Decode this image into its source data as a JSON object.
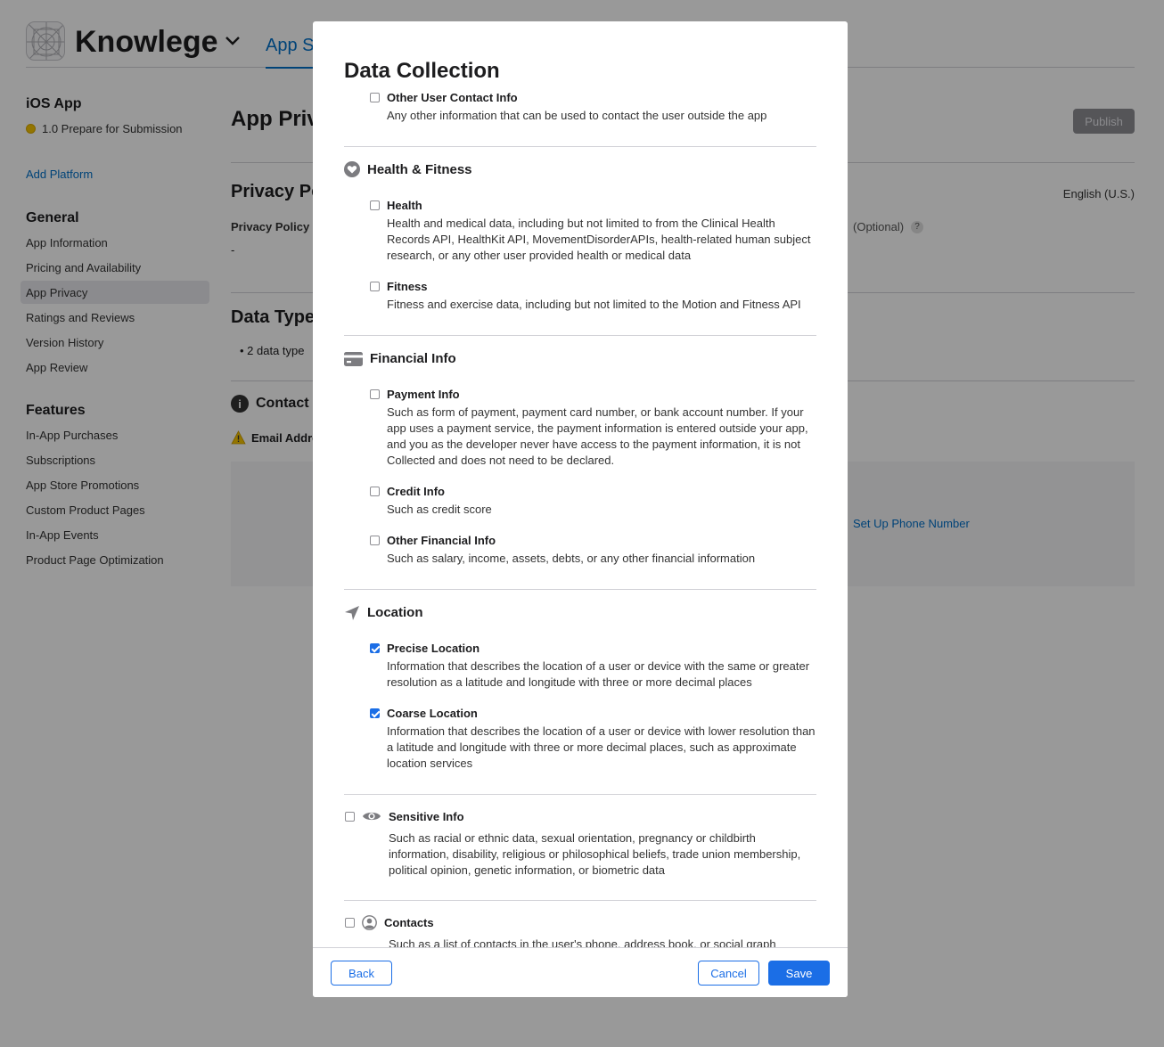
{
  "app": {
    "title": "Knowlege",
    "tab_appstore": "App St"
  },
  "sidebar": {
    "platform": "iOS App",
    "status": "1.0 Prepare for Submission",
    "add_platform": "Add Platform",
    "general_header": "General",
    "general_items": [
      "App Information",
      "Pricing and Availability",
      "App Privacy",
      "Ratings and Reviews",
      "Version History",
      "App Review"
    ],
    "features_header": "Features",
    "feature_items": [
      "In-App Purchases",
      "Subscriptions",
      "App Store Promotions",
      "Custom Product Pages",
      "In-App Events",
      "Product Page Optimization"
    ]
  },
  "main": {
    "title": "App Priv",
    "publish": "Publish",
    "privacy_policy_heading": "Privacy Po",
    "language": "English (U.S.)",
    "privacy_policy_url_label": "Privacy Policy U",
    "privacy_policy_url_value": "-",
    "optional_label": "(Optional)",
    "help_mark": "?",
    "data_types_heading": "Data Type",
    "data_types_bullet": "2 data type",
    "contact_info": "Contact I",
    "email_warning": "Email Addre",
    "set_up_phone": "Set Up Phone Number"
  },
  "modal": {
    "title": "Data Collection",
    "items": {
      "other_contact": {
        "title": "Other User Contact Info",
        "desc": "Any other information that can be used to contact the user outside the app"
      },
      "health": {
        "title": "Health",
        "desc": "Health and medical data, including but not limited to from the Clinical Health Records API, HealthKit API, MovementDisorderAPIs, health-related human subject research, or any other user provided health or medical data"
      },
      "fitness": {
        "title": "Fitness",
        "desc": "Fitness and exercise data, including but not limited to the Motion and Fitness API"
      },
      "payment": {
        "title": "Payment Info",
        "desc": "Such as form of payment, payment card number, or bank account number. If your app uses a payment service, the payment information is entered outside your app, and you as the developer never have access to the payment information, it is not Collected and does not need to be declared."
      },
      "credit": {
        "title": "Credit Info",
        "desc": "Such as credit score"
      },
      "other_financial": {
        "title": "Other Financial Info",
        "desc": "Such as salary, income, assets, debts, or any other financial information"
      },
      "precise_location": {
        "title": "Precise Location",
        "desc": "Information that describes the location of a user or device with the same or greater resolution as a latitude and longitude with three or more decimal places",
        "checked": true
      },
      "coarse_location": {
        "title": "Coarse Location",
        "desc": "Information that describes the location of a user or device with lower resolution than a latitude and longitude with three or more decimal places, such as approximate location services",
        "checked": true
      },
      "sensitive": {
        "title": "Sensitive Info",
        "desc": "Such as racial or ethnic data, sexual orientation, pregnancy or childbirth information, disability, religious or philosophical beliefs, trade union membership, political opinion, genetic information, or biometric data"
      },
      "contacts": {
        "title": "Contacts",
        "desc": "Such as a list of contacts in the user's phone, address book, or social graph"
      }
    },
    "categories": {
      "health_fitness": "Health & Fitness",
      "financial": "Financial Info",
      "location": "Location"
    },
    "buttons": {
      "back": "Back",
      "cancel": "Cancel",
      "save": "Save"
    }
  },
  "colors": {
    "accent": "#1b6ee6",
    "link": "#0070c9",
    "overlay": "rgba(0,0,0,0.4)"
  }
}
